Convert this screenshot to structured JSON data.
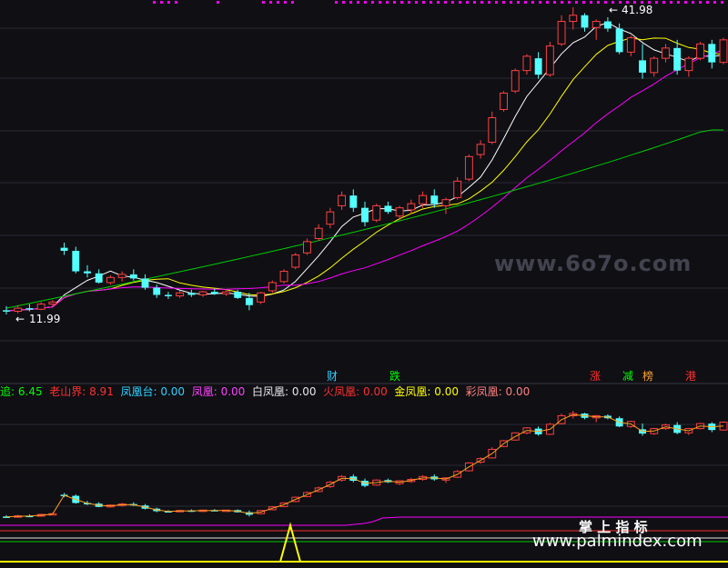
{
  "main_chart": {
    "high_label": "41.98",
    "low_label": "11.99",
    "watermark": "www.6o7o.com",
    "colors": {
      "background": "#0f0f14",
      "grid": "#2a2a35",
      "up": "#ff4040",
      "down": "#54ffff",
      "ma_white": "#ffffff",
      "ma_yellow": "#ffff00",
      "ma_magenta": "#ff00ff",
      "ma_green": "#00cc00"
    }
  },
  "chart_data": {
    "type": "candlestick",
    "price_labels": {
      "high": 41.98,
      "low": 11.99
    },
    "ohlc_approx": [
      [
        12.4,
        12.8,
        11.99,
        12.3
      ],
      [
        12.3,
        12.9,
        12.1,
        12.6
      ],
      [
        12.6,
        13.0,
        12.3,
        12.5
      ],
      [
        12.5,
        13.2,
        12.4,
        13.0
      ],
      [
        13.0,
        13.4,
        12.8,
        13.2
      ],
      [
        18.5,
        19.0,
        17.8,
        18.2
      ],
      [
        18.2,
        18.6,
        16.0,
        16.2
      ],
      [
        16.2,
        16.8,
        15.6,
        16.0
      ],
      [
        16.0,
        16.4,
        15.0,
        15.1
      ],
      [
        15.1,
        15.8,
        14.9,
        15.6
      ],
      [
        15.6,
        16.2,
        15.2,
        15.9
      ],
      [
        15.9,
        16.4,
        15.3,
        15.5
      ],
      [
        15.5,
        15.9,
        14.4,
        14.6
      ],
      [
        14.6,
        14.9,
        13.6,
        13.9
      ],
      [
        13.9,
        14.2,
        13.5,
        13.8
      ],
      [
        13.8,
        14.3,
        13.6,
        14.1
      ],
      [
        14.1,
        14.4,
        13.7,
        13.9
      ],
      [
        13.9,
        14.3,
        13.7,
        14.2
      ],
      [
        14.2,
        14.5,
        13.9,
        14.0
      ],
      [
        14.0,
        14.3,
        13.8,
        14.2
      ],
      [
        14.2,
        14.4,
        13.5,
        13.6
      ],
      [
        13.6,
        14.1,
        12.4,
        12.9
      ],
      [
        13.2,
        14.2,
        13.0,
        14.1
      ],
      [
        14.3,
        15.3,
        14.1,
        15.1
      ],
      [
        15.2,
        16.4,
        15.0,
        16.2
      ],
      [
        16.6,
        18.0,
        16.4,
        17.8
      ],
      [
        18.0,
        19.4,
        17.8,
        19.1
      ],
      [
        19.4,
        20.8,
        19.2,
        20.4
      ],
      [
        20.8,
        22.4,
        20.4,
        22.0
      ],
      [
        22.6,
        24.0,
        22.2,
        23.6
      ],
      [
        23.6,
        24.2,
        22.0,
        22.4
      ],
      [
        22.4,
        23.0,
        20.6,
        21.0
      ],
      [
        21.2,
        22.8,
        21.0,
        22.6
      ],
      [
        22.6,
        23.0,
        21.8,
        22.0
      ],
      [
        21.6,
        22.6,
        21.2,
        22.4
      ],
      [
        22.2,
        23.2,
        21.8,
        22.8
      ],
      [
        22.8,
        24.0,
        22.4,
        23.6
      ],
      [
        23.6,
        24.2,
        22.4,
        22.8
      ],
      [
        22.6,
        23.4,
        21.8,
        23.2
      ],
      [
        23.4,
        25.4,
        23.2,
        25.0
      ],
      [
        25.2,
        27.6,
        25.0,
        27.4
      ],
      [
        27.6,
        29.0,
        27.2,
        28.6
      ],
      [
        28.8,
        31.8,
        28.6,
        31.2
      ],
      [
        32.0,
        33.8,
        31.8,
        33.6
      ],
      [
        33.8,
        36.0,
        33.6,
        35.8
      ],
      [
        35.8,
        37.4,
        35.4,
        37.2
      ],
      [
        37.0,
        37.6,
        35.0,
        35.4
      ],
      [
        35.4,
        38.6,
        35.2,
        38.2
      ],
      [
        38.4,
        41.2,
        38.2,
        40.6
      ],
      [
        40.6,
        41.98,
        39.8,
        41.2
      ],
      [
        41.2,
        41.4,
        39.6,
        40.0
      ],
      [
        40.0,
        40.8,
        38.8,
        40.6
      ],
      [
        40.6,
        41.0,
        39.6,
        39.9
      ],
      [
        39.9,
        40.4,
        37.4,
        37.6
      ],
      [
        37.6,
        39.2,
        37.2,
        39.0
      ],
      [
        36.8,
        38.4,
        35.0,
        35.6
      ],
      [
        35.6,
        37.2,
        35.2,
        37.0
      ],
      [
        37.0,
        38.4,
        36.6,
        38.0
      ],
      [
        38.0,
        38.8,
        35.4,
        35.8
      ],
      [
        35.8,
        37.2,
        35.2,
        37.0
      ],
      [
        37.0,
        38.6,
        36.8,
        38.4
      ],
      [
        38.4,
        38.8,
        36.0,
        36.6
      ],
      [
        36.6,
        39.0,
        36.4,
        38.8
      ]
    ],
    "moving_averages": [
      "white",
      "yellow",
      "magenta",
      "green"
    ]
  },
  "flags": {
    "cai": "财",
    "die": "跌",
    "zhang": "涨",
    "jian": "减",
    "bang": "榜",
    "gang": "港"
  },
  "indicators": [
    {
      "label": "追:",
      "value": "6.45",
      "color": "#00ff00"
    },
    {
      "label": "老山界:",
      "value": "8.91",
      "color": "#ff3030"
    },
    {
      "label": "凤凰台:",
      "value": "0.00",
      "color": "#30d0ff"
    },
    {
      "label": "凤凰:",
      "value": "0.00",
      "color": "#ff40ff"
    },
    {
      "label": "白凤凰:",
      "value": "0.00",
      "color": "#e8e8e8"
    },
    {
      "label": "火凤凰:",
      "value": "0.00",
      "color": "#ff3030"
    },
    {
      "label": "金凤凰:",
      "value": "0.00",
      "color": "#ffff00"
    },
    {
      "label": "彩凤凰:",
      "value": "0.00",
      "color": "#ff8080"
    }
  ],
  "watermark2": {
    "title": "掌 上 指 标",
    "url": "www.palmindex.com"
  }
}
